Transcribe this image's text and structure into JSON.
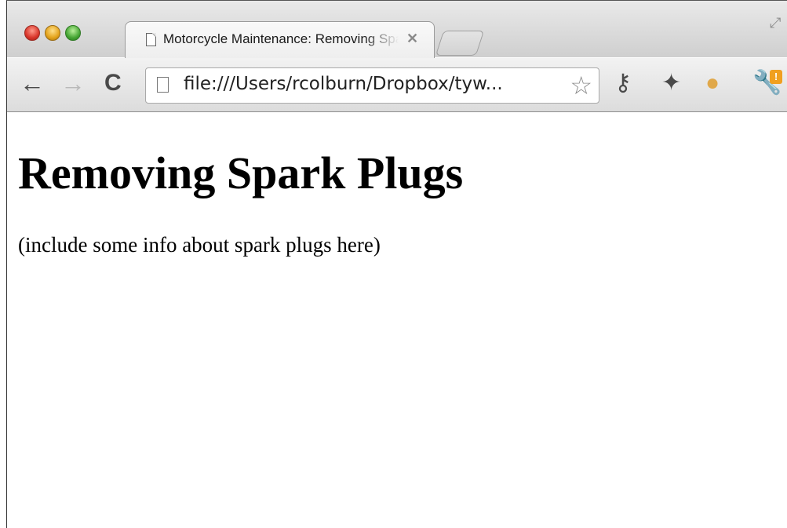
{
  "tab": {
    "title": "Motorcycle Maintenance: Removing Spark Plugs",
    "close_glyph": "✕"
  },
  "toolbar": {
    "back_glyph": "←",
    "forward_glyph": "→",
    "reload_glyph": "C",
    "address": "file:///Users/rcolburn/Dropbox/tyw...",
    "star_glyph": "☆",
    "extension_icons": [
      "key-icon",
      "pin-icon",
      "puffer-fish-icon",
      "wrench-icon"
    ],
    "wrench_badge": "!"
  },
  "page": {
    "heading": "Removing Spark Plugs",
    "paragraph": "(include some info about spark plugs here)"
  },
  "colors": {
    "close": "#d8352a",
    "minimize": "#e3a21a",
    "maximize": "#45a533",
    "badge": "#f0a020"
  }
}
